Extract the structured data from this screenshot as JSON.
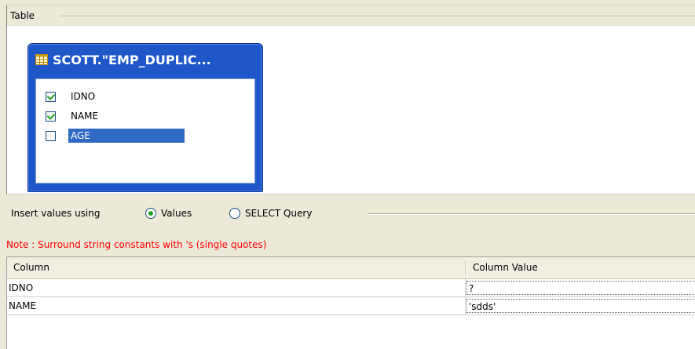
{
  "table_group": {
    "title": "Table"
  },
  "table_widget": {
    "title": "SCOTT.\"EMP_DUPLIC...",
    "icon": "table-icon",
    "columns": [
      {
        "label": "IDNO",
        "checked": true,
        "selected": false
      },
      {
        "label": "NAME",
        "checked": true,
        "selected": false
      },
      {
        "label": "AGE",
        "checked": false,
        "selected": true
      }
    ]
  },
  "insert": {
    "label": "Insert values using",
    "options": [
      {
        "label": "Values",
        "selected": true
      },
      {
        "label": "SELECT Query",
        "selected": false
      }
    ]
  },
  "note": "Note : Surround string constants with 's (single quotes)",
  "grid": {
    "headers": [
      "Column",
      "Column Value"
    ],
    "rows": [
      {
        "column": "IDNO",
        "value": "?"
      },
      {
        "column": "NAME",
        "value": "'sdds'"
      }
    ]
  },
  "colors": {
    "widget_blue": "#1f57c9",
    "selection_blue": "#316ac5",
    "note_red": "#ff0000",
    "check_green": "#21a121"
  }
}
